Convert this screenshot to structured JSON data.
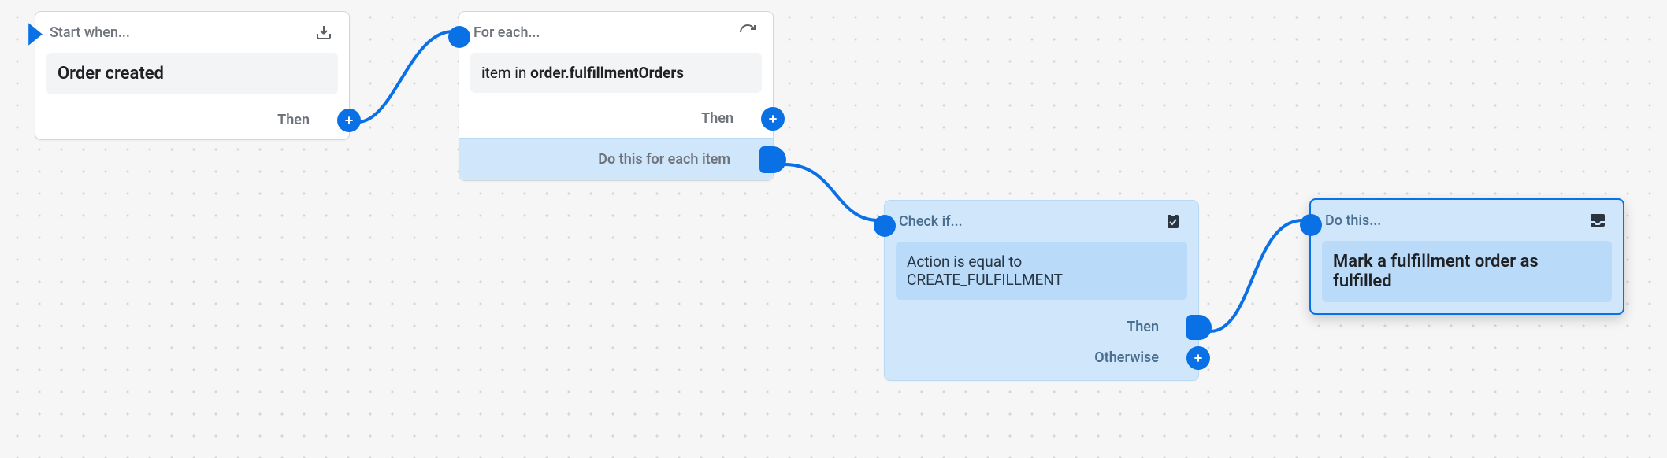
{
  "colors": {
    "accent": "#0970e6",
    "blue_bg": "#cfe6fb",
    "blue_body": "#b9daf8"
  },
  "node1": {
    "title": "Start when...",
    "icon": "download-icon",
    "trigger": "Order created",
    "then": "Then"
  },
  "node2": {
    "title": "For each...",
    "icon": "refresh-icon",
    "item_prefix": "item in ",
    "item_bold": "order.fulfillmentOrders",
    "then": "Then",
    "do_each": "Do this for each item"
  },
  "node3": {
    "title": "Check if...",
    "icon": "clipboard-check-icon",
    "condition": "Action is equal to CREATE_FULFILLMENT",
    "then": "Then",
    "otherwise": "Otherwise"
  },
  "node4": {
    "title": "Do this...",
    "icon": "inbox-icon",
    "action": "Mark a fulfillment order as fulfilled"
  }
}
